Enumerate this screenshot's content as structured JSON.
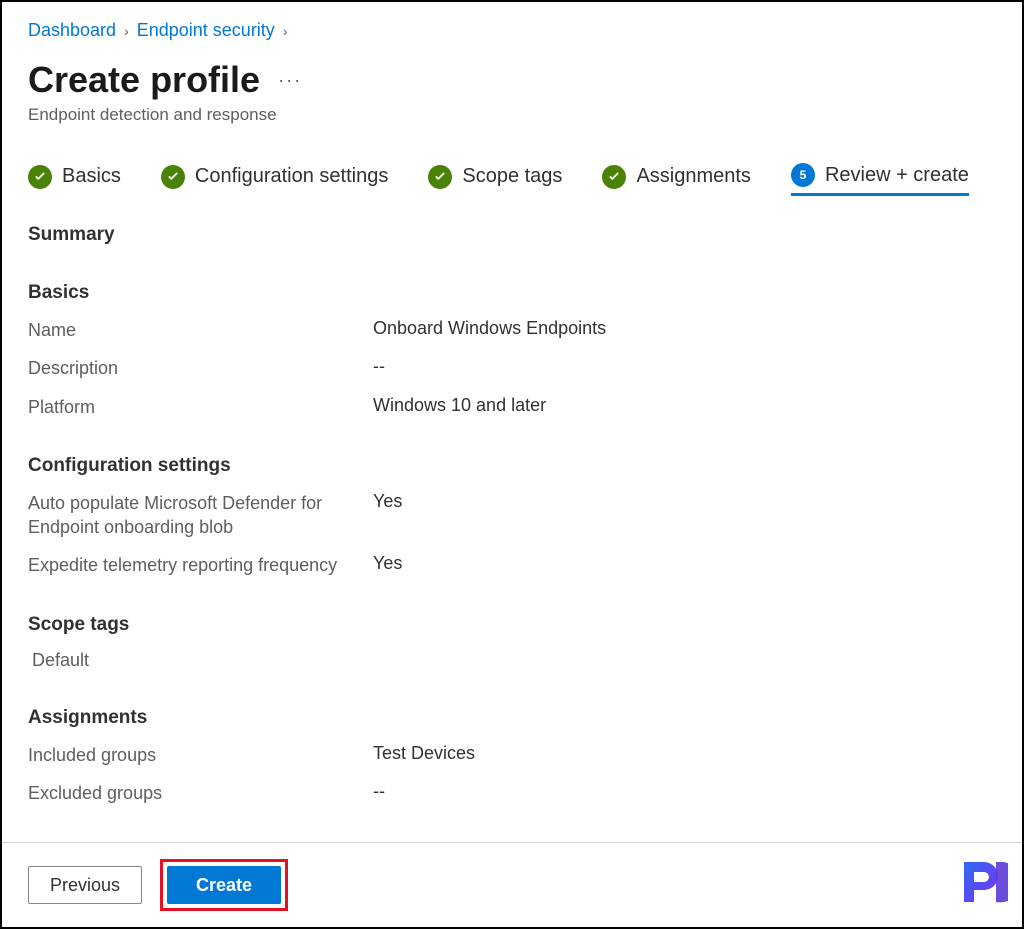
{
  "breadcrumb": {
    "items": [
      "Dashboard",
      "Endpoint security"
    ]
  },
  "header": {
    "title": "Create profile",
    "more": "···",
    "subtitle": "Endpoint detection and response"
  },
  "steps": [
    {
      "label": "Basics",
      "state": "done"
    },
    {
      "label": "Configuration settings",
      "state": "done"
    },
    {
      "label": "Scope tags",
      "state": "done"
    },
    {
      "label": "Assignments",
      "state": "done"
    },
    {
      "label": "Review + create",
      "state": "current",
      "badge": "5"
    }
  ],
  "summary": {
    "heading": "Summary",
    "sections": {
      "basics": {
        "title": "Basics",
        "name_label": "Name",
        "name_value": "Onboard Windows Endpoints",
        "description_label": "Description",
        "description_value": "--",
        "platform_label": "Platform",
        "platform_value": "Windows 10 and later"
      },
      "config": {
        "title": "Configuration settings",
        "row1_label": "Auto populate Microsoft Defender for Endpoint onboarding blob",
        "row1_value": "Yes",
        "row2_label": "Expedite telemetry reporting frequency",
        "row2_value": "Yes"
      },
      "scope": {
        "title": "Scope tags",
        "tag": "Default"
      },
      "assignments": {
        "title": "Assignments",
        "included_label": "Included groups",
        "included_value": "Test Devices",
        "excluded_label": "Excluded groups",
        "excluded_value": "--"
      }
    }
  },
  "footer": {
    "previous": "Previous",
    "create": "Create"
  }
}
